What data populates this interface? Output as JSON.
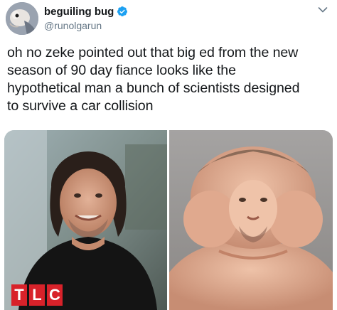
{
  "tweet": {
    "display_name": "beguiling bug",
    "handle": "@runolgarun",
    "verified": true,
    "text_lines": [
      "oh no zeke pointed out that big ed from the new",
      "season of 90 day fiance looks like the",
      "hypothetical man a bunch of scientists designed",
      "to survive a car collision"
    ]
  },
  "media": {
    "left_photo": {
      "logo_letters": [
        "T",
        "L",
        "C"
      ]
    }
  },
  "icons": {
    "verified": "verified-badge-icon",
    "menu": "chevron-down-icon"
  },
  "colors": {
    "text_primary": "#14171a",
    "text_secondary": "#657786",
    "verified_blue": "#1da1f2",
    "tlc_red": "#d8222a"
  }
}
